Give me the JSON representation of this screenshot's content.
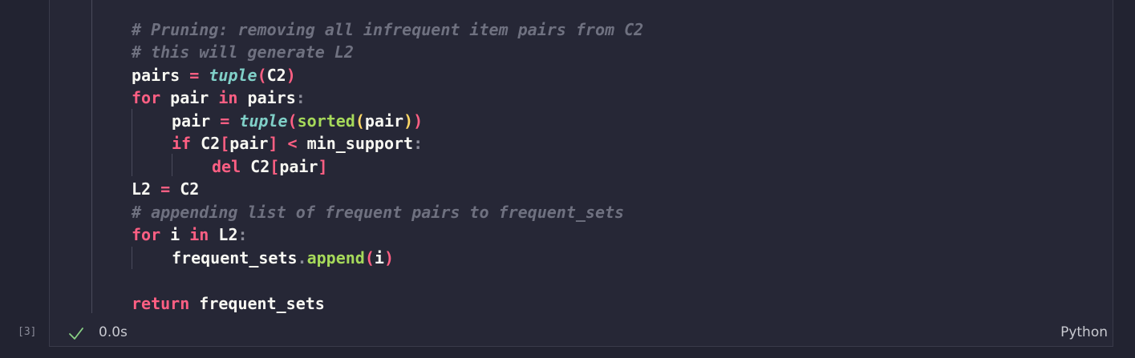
{
  "code": {
    "comment1": "# Pruning: removing all infrequent item pairs from C2",
    "comment2": "# this will generate L2",
    "pairs_var": "pairs",
    "eq": "=",
    "tuple_fn": "tuple",
    "c2": "C2",
    "for_kw": "for",
    "pair_var": "pair",
    "in_kw": "in",
    "colon": ":",
    "sorted_fn": "sorted",
    "if_kw": "if",
    "lt": "<",
    "min_support": "min_support",
    "del_kw": "del",
    "l2": "L2",
    "comment3": "# appending list of frequent pairs to frequent_sets",
    "i_var": "i",
    "frequent_sets": "frequent_sets",
    "dot": ".",
    "append_fn": "append",
    "return_kw": "return",
    "lparen": "(",
    "rparen": ")",
    "lbracket": "[",
    "rbracket": "]"
  },
  "status": {
    "execution_count": "[3]",
    "duration": "0.0s",
    "icon": "check-icon",
    "success_color": "#89d185"
  },
  "language": "Python"
}
